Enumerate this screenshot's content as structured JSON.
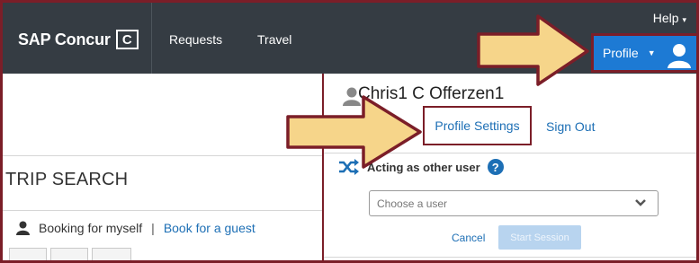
{
  "topbar": {
    "logo_text": "SAP Concur",
    "logo_mark": "C",
    "nav": [
      "Requests",
      "Travel"
    ],
    "help": "Help",
    "profile_label": "Profile"
  },
  "left": {
    "trip_search": "TRIP SEARCH",
    "booking_self": "Booking for myself",
    "separator": "|",
    "book_guest": "Book for a guest"
  },
  "profile_menu": {
    "user_name": "Chris1 C Offerzen1",
    "profile_settings": "Profile Settings",
    "sign_out": "Sign Out",
    "acting_label": "Acting as other user",
    "help_glyph": "?",
    "select_placeholder": "Choose a user",
    "cancel": "Cancel",
    "start_session": "Start Session"
  },
  "colors": {
    "topbar": "#353c43",
    "accent_blue": "#1d7ad4",
    "link_blue": "#1d6fb5",
    "highlight_border": "#7b1e28",
    "arrow_fill": "#f6d58a"
  },
  "icons": [
    "person-icon",
    "chevron-down-icon",
    "shuffle-icon",
    "help-circle-icon",
    "avatar-icon"
  ]
}
